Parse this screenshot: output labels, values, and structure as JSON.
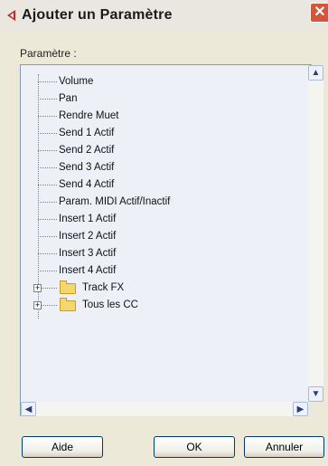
{
  "window": {
    "title": "Ajouter un Paramètre",
    "close_label": "✕"
  },
  "group": {
    "label": "Paramètre :"
  },
  "tree": {
    "items": [
      {
        "label": "Volume"
      },
      {
        "label": "Pan"
      },
      {
        "label": "Rendre Muet"
      },
      {
        "label": "Send 1 Actif"
      },
      {
        "label": "Send 2 Actif"
      },
      {
        "label": "Send 3 Actif"
      },
      {
        "label": "Send 4 Actif"
      },
      {
        "label": "Param. MIDI Actif/Inactif"
      },
      {
        "label": "Insert 1 Actif"
      },
      {
        "label": "Insert 2 Actif"
      },
      {
        "label": "Insert 3 Actif"
      },
      {
        "label": "Insert 4 Actif"
      }
    ],
    "folders": [
      {
        "label": "Track FX",
        "expand": "+"
      },
      {
        "label": "Tous les CC",
        "expand": "+"
      }
    ]
  },
  "scroll": {
    "up": "▲",
    "down": "▼",
    "left": "◀",
    "right": "▶"
  },
  "buttons": {
    "help": "Aide",
    "ok": "OK",
    "cancel": "Annuler"
  },
  "colors": {
    "accent_red": "#c4262e",
    "tree_background": "#eef0f7",
    "dialog_background": "#ece9d8"
  }
}
